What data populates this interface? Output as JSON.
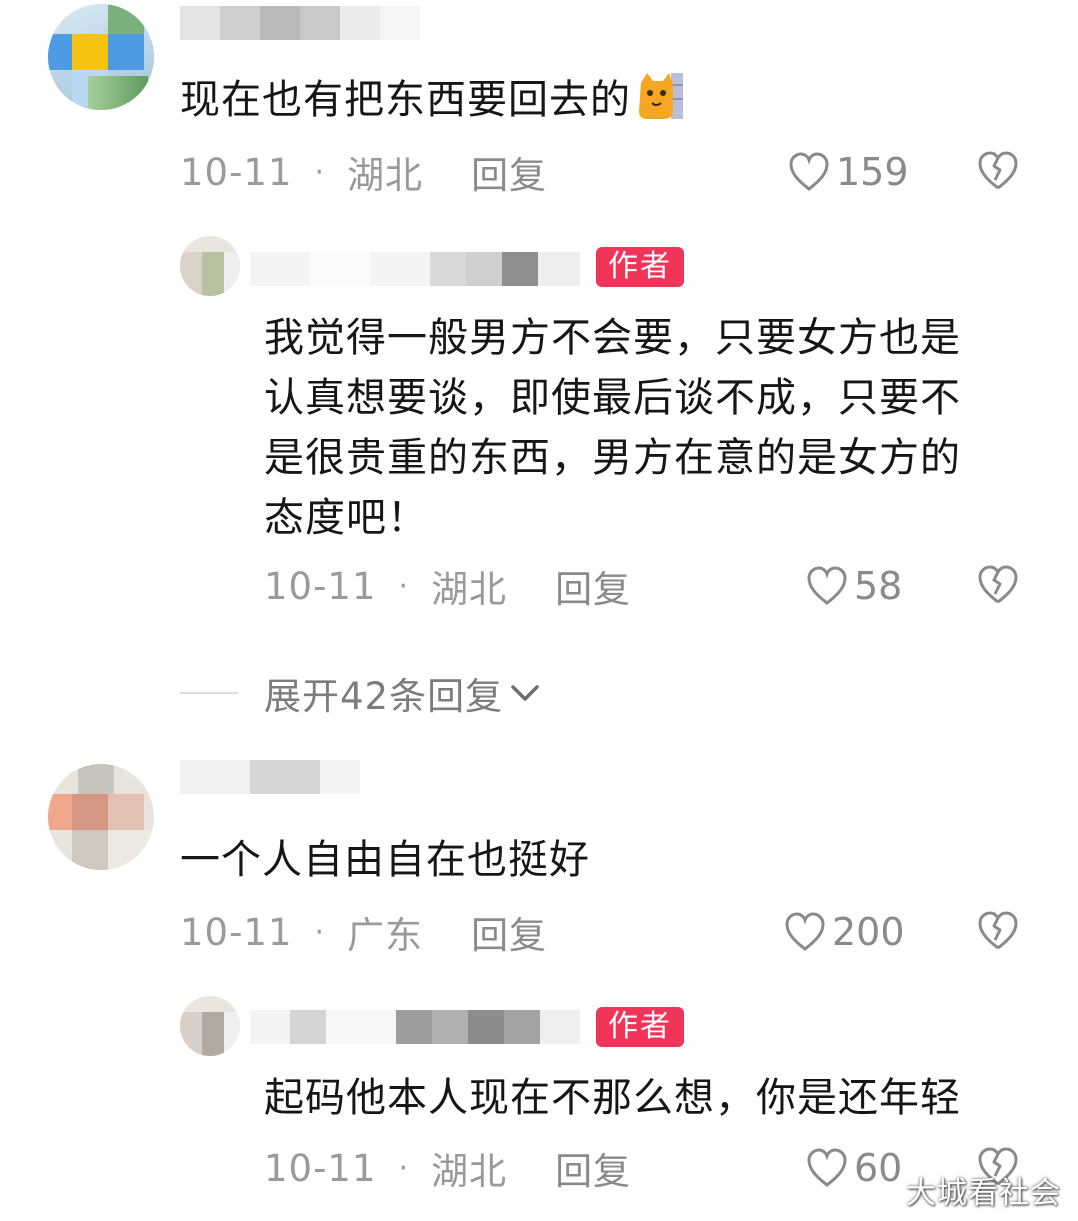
{
  "comments": [
    {
      "text": "现在也有把东西要回去的",
      "emoji": "cat-emoji",
      "date": "10-11",
      "location": "湖北",
      "reply_label": "回复",
      "likes": "159",
      "reply": {
        "badge": "作者",
        "text_lines": [
          "我觉得一般男方不会要，只要女方也是",
          "认真想要谈，即使最后谈不成，只要不",
          "是很贵重的东西，男方在意的是女方的",
          "态度吧！"
        ],
        "date": "10-11",
        "location": "湖北",
        "reply_label": "回复",
        "likes": "58"
      },
      "expand_label": "展开42条回复"
    },
    {
      "text": "一个人自由自在也挺好",
      "date": "10-11",
      "location": "广东",
      "reply_label": "回复",
      "likes": "200",
      "reply": {
        "badge": "作者",
        "text_lines": [
          "起码他本人现在不那么想，你是还年轻"
        ],
        "date": "10-11",
        "location": "湖北",
        "reply_label": "回复",
        "likes": "60"
      }
    }
  ],
  "watermark": "大城看社会",
  "colors": {
    "badge": "#f0345a",
    "meta": "#9a9a9a",
    "text": "#161616"
  }
}
